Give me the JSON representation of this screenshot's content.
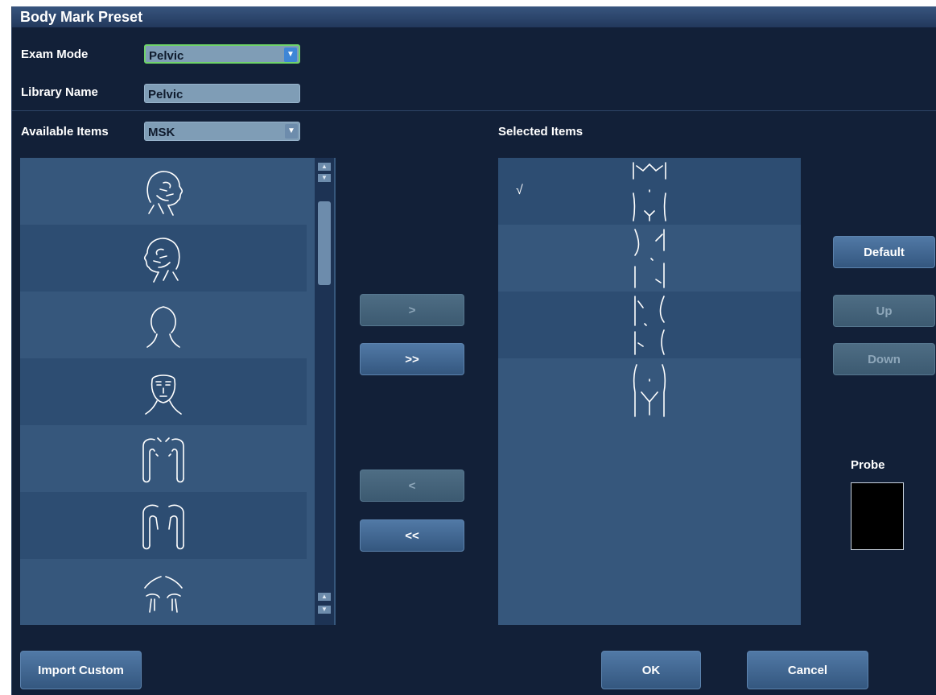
{
  "window": {
    "title": "Body Mark Preset"
  },
  "exam_mode": {
    "label": "Exam Mode",
    "value": "Pelvic"
  },
  "library_name": {
    "label": "Library Name",
    "value": "Pelvic"
  },
  "available_items": {
    "label": "Available Items",
    "category": "MSK",
    "items": [
      {
        "icon": "head-side-view-icon"
      },
      {
        "icon": "head-side-view-alt-icon"
      },
      {
        "icon": "head-back-view-icon"
      },
      {
        "icon": "face-front-view-icon"
      },
      {
        "icon": "shoulders-arms-front-icon"
      },
      {
        "icon": "shoulders-arms-back-icon"
      },
      {
        "icon": "chest-shoulders-icon"
      }
    ]
  },
  "selected_items": {
    "label": "Selected Items",
    "check_mark": "√",
    "items": [
      {
        "icon": "pelvis-torso-body-mark-1-icon",
        "checked": true
      },
      {
        "icon": "pelvis-torso-body-mark-2-icon",
        "checked": false
      },
      {
        "icon": "pelvis-torso-body-mark-3-icon",
        "checked": false
      },
      {
        "icon": "pelvis-lower-body-mark-icon",
        "checked": false
      }
    ]
  },
  "transfer": {
    "add_one": ">",
    "add_all": ">>",
    "remove_one": "<",
    "remove_all": "<<"
  },
  "side_buttons": {
    "default": "Default",
    "up": "Up",
    "down": "Down"
  },
  "probe": {
    "label": "Probe"
  },
  "footer": {
    "import_custom": "Import Custom",
    "ok": "OK",
    "cancel": "Cancel"
  }
}
